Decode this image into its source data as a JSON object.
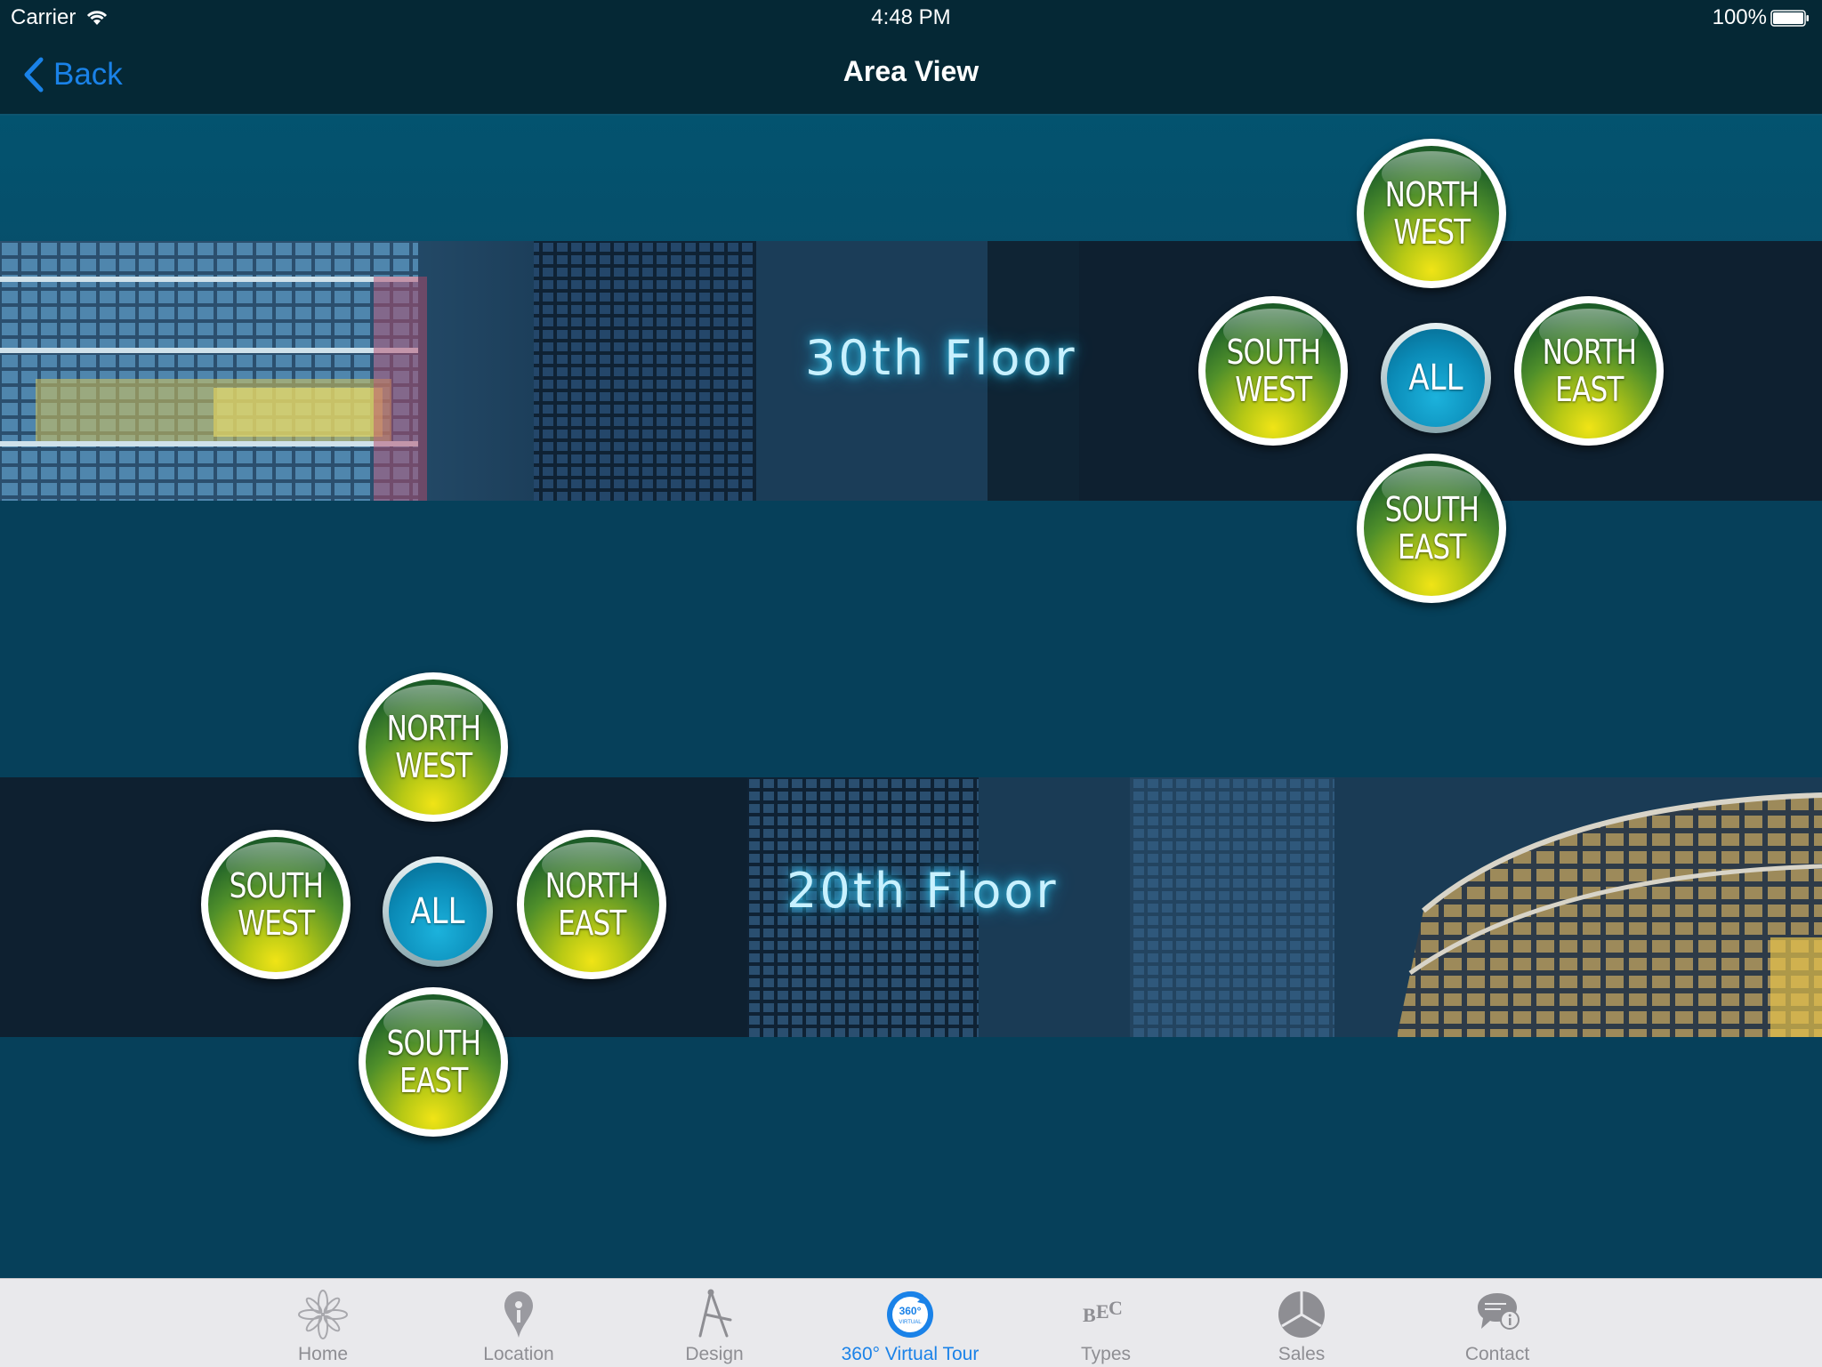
{
  "status_bar": {
    "carrier": "Carrier",
    "time": "4:48 PM",
    "battery": "100%"
  },
  "nav": {
    "back_label": "Back",
    "title": "Area View"
  },
  "floors": [
    {
      "label": "30th Floor",
      "buttons": {
        "north_west": [
          "NORTH",
          "WEST"
        ],
        "south_west": [
          "SOUTH",
          "WEST"
        ],
        "all": "ALL",
        "north_east": [
          "NORTH",
          "EAST"
        ],
        "south_east": [
          "SOUTH",
          "EAST"
        ]
      }
    },
    {
      "label": "20th Floor",
      "buttons": {
        "north_west": [
          "NORTH",
          "WEST"
        ],
        "south_west": [
          "SOUTH",
          "WEST"
        ],
        "all": "ALL",
        "north_east": [
          "NORTH",
          "EAST"
        ],
        "south_east": [
          "SOUTH",
          "EAST"
        ]
      }
    }
  ],
  "tabs": [
    {
      "label": "Home",
      "icon": "flower-icon",
      "active": false
    },
    {
      "label": "Location",
      "icon": "location-pin-icon",
      "active": false
    },
    {
      "label": "Design",
      "icon": "drafting-compass-icon",
      "active": false
    },
    {
      "label": "360° Virtual Tour",
      "icon": "virtual-tour-360-icon",
      "active": true
    },
    {
      "label": "Types",
      "icon": "types-letters-icon",
      "active": false
    },
    {
      "label": "Sales",
      "icon": "pie-chart-icon",
      "active": false
    },
    {
      "label": "Contact",
      "icon": "chat-info-icon",
      "active": false
    }
  ],
  "colors": {
    "accent": "#1a82e8",
    "nav_background": "#052835",
    "content_background": "#06405a",
    "direction_button": "#2d7a2a",
    "all_button": "#0b8cb8",
    "tab_inactive": "#8e8e93"
  }
}
